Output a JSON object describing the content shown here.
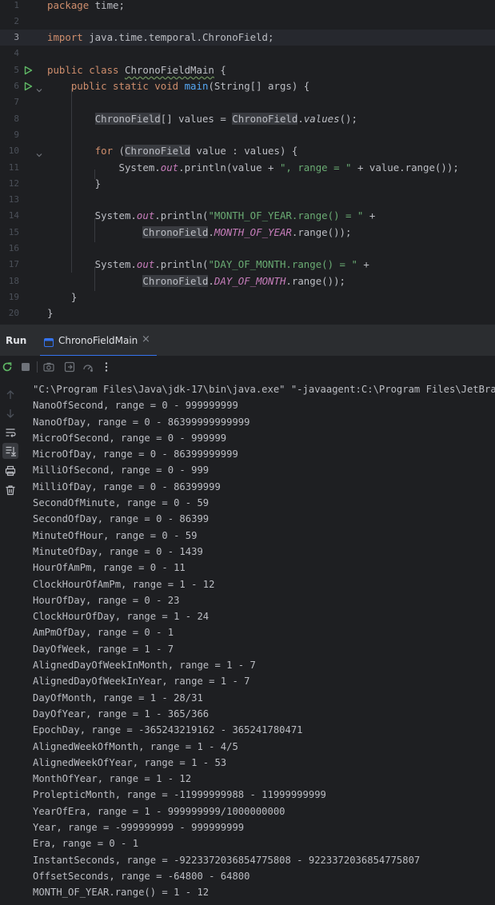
{
  "editor": {
    "lines": [
      {
        "n": "1",
        "segs": [
          {
            "t": "package",
            "c": "kw"
          },
          {
            "t": " time;"
          }
        ]
      },
      {
        "n": "2",
        "segs": []
      },
      {
        "n": "3",
        "current": true,
        "segs": [
          {
            "t": "import",
            "c": "kw"
          },
          {
            "t": " java.time.temporal.ChronoField;"
          }
        ]
      },
      {
        "n": "4",
        "segs": []
      },
      {
        "n": "5",
        "run": true,
        "segs": [
          {
            "t": "public class",
            "c": "kw"
          },
          {
            "t": " "
          },
          {
            "t": "ChronoFieldMain",
            "c": "ul"
          },
          {
            "t": " {"
          }
        ]
      },
      {
        "n": "6",
        "run": true,
        "fold": true,
        "segs": [
          {
            "t": "    "
          },
          {
            "t": "public static void",
            "c": "kw"
          },
          {
            "t": " "
          },
          {
            "t": "main",
            "c": "fn"
          },
          {
            "t": "(String[] args) {"
          }
        ]
      },
      {
        "n": "7",
        "segs": []
      },
      {
        "n": "8",
        "segs": [
          {
            "t": "        "
          },
          {
            "t": "ChronoField",
            "c": "hl"
          },
          {
            "t": "[] values = "
          },
          {
            "t": "ChronoField",
            "c": "hl"
          },
          {
            "t": "."
          },
          {
            "t": "values",
            "c": "it"
          },
          {
            "t": "();"
          }
        ]
      },
      {
        "n": "9",
        "segs": []
      },
      {
        "n": "10",
        "fold": true,
        "segs": [
          {
            "t": "        "
          },
          {
            "t": "for",
            "c": "kw"
          },
          {
            "t": " ("
          },
          {
            "t": "ChronoField",
            "c": "hl"
          },
          {
            "t": " value : values) {"
          }
        ]
      },
      {
        "n": "11",
        "segs": [
          {
            "t": "            System."
          },
          {
            "t": "out",
            "c": "st"
          },
          {
            "t": ".println(value + "
          },
          {
            "t": "\", range = \"",
            "c": "str"
          },
          {
            "t": " + value.range());"
          }
        ]
      },
      {
        "n": "12",
        "segs": [
          {
            "t": "        }"
          }
        ]
      },
      {
        "n": "13",
        "segs": []
      },
      {
        "n": "14",
        "segs": [
          {
            "t": "        System."
          },
          {
            "t": "out",
            "c": "st"
          },
          {
            "t": ".println("
          },
          {
            "t": "\"MONTH_OF_YEAR.range() = \"",
            "c": "str"
          },
          {
            "t": " +"
          }
        ]
      },
      {
        "n": "15",
        "segs": [
          {
            "t": "                "
          },
          {
            "t": "ChronoField",
            "c": "hl"
          },
          {
            "t": "."
          },
          {
            "t": "MONTH_OF_YEAR",
            "c": "st"
          },
          {
            "t": ".range());"
          }
        ]
      },
      {
        "n": "16",
        "segs": []
      },
      {
        "n": "17",
        "segs": [
          {
            "t": "        System."
          },
          {
            "t": "out",
            "c": "st"
          },
          {
            "t": ".println("
          },
          {
            "t": "\"DAY_OF_MONTH.range() = \"",
            "c": "str"
          },
          {
            "t": " +"
          }
        ]
      },
      {
        "n": "18",
        "segs": [
          {
            "t": "                "
          },
          {
            "t": "ChronoField",
            "c": "hl"
          },
          {
            "t": "."
          },
          {
            "t": "DAY_OF_MONTH",
            "c": "st"
          },
          {
            "t": ".range());"
          }
        ]
      },
      {
        "n": "19",
        "segs": [
          {
            "t": "    }"
          }
        ]
      },
      {
        "n": "20",
        "segs": [
          {
            "t": "}"
          }
        ]
      }
    ]
  },
  "run_panel": {
    "title": "Run",
    "tab_label": "ChronoFieldMain",
    "tab_close": "×",
    "icons": [
      "rerun-icon",
      "stop-icon",
      "screenshot-icon",
      "restore-layout-icon",
      "profiler-icon",
      "more-icon"
    ],
    "side_icons": [
      "up-arrow-icon",
      "down-arrow-icon",
      "soft-wrap-icon",
      "scroll-to-end-icon",
      "print-icon",
      "trash-icon"
    ]
  },
  "console": {
    "lines": [
      "\"C:\\Program Files\\Java\\jdk-17\\bin\\java.exe\" \"-javaagent:C:\\Program Files\\JetBra",
      "NanoOfSecond, range = 0 - 999999999",
      "NanoOfDay, range = 0 - 86399999999999",
      "MicroOfSecond, range = 0 - 999999",
      "MicroOfDay, range = 0 - 86399999999",
      "MilliOfSecond, range = 0 - 999",
      "MilliOfDay, range = 0 - 86399999",
      "SecondOfMinute, range = 0 - 59",
      "SecondOfDay, range = 0 - 86399",
      "MinuteOfHour, range = 0 - 59",
      "MinuteOfDay, range = 0 - 1439",
      "HourOfAmPm, range = 0 - 11",
      "ClockHourOfAmPm, range = 1 - 12",
      "HourOfDay, range = 0 - 23",
      "ClockHourOfDay, range = 1 - 24",
      "AmPmOfDay, range = 0 - 1",
      "DayOfWeek, range = 1 - 7",
      "AlignedDayOfWeekInMonth, range = 1 - 7",
      "AlignedDayOfWeekInYear, range = 1 - 7",
      "DayOfMonth, range = 1 - 28/31",
      "DayOfYear, range = 1 - 365/366",
      "EpochDay, range = -365243219162 - 365241780471",
      "AlignedWeekOfMonth, range = 1 - 4/5",
      "AlignedWeekOfYear, range = 1 - 53",
      "MonthOfYear, range = 1 - 12",
      "ProlepticMonth, range = -11999999988 - 11999999999",
      "YearOfEra, range = 1 - 999999999/1000000000",
      "Year, range = -999999999 - 999999999",
      "Era, range = 0 - 1",
      "InstantSeconds, range = -9223372036854775808 - 9223372036854775807",
      "OffsetSeconds, range = -64800 - 64800",
      "MONTH_OF_YEAR.range() = 1 - 12"
    ]
  },
  "colors": {
    "editor_bg": "#1e1f22",
    "panel_bg": "#2b2d30",
    "keyword": "#cf8e6d",
    "string": "#6aab73",
    "static_field": "#c77dbb",
    "method": "#56a8f5",
    "text": "#bcbec4",
    "accent": "#3574f0",
    "run_green": "#5fb865"
  }
}
